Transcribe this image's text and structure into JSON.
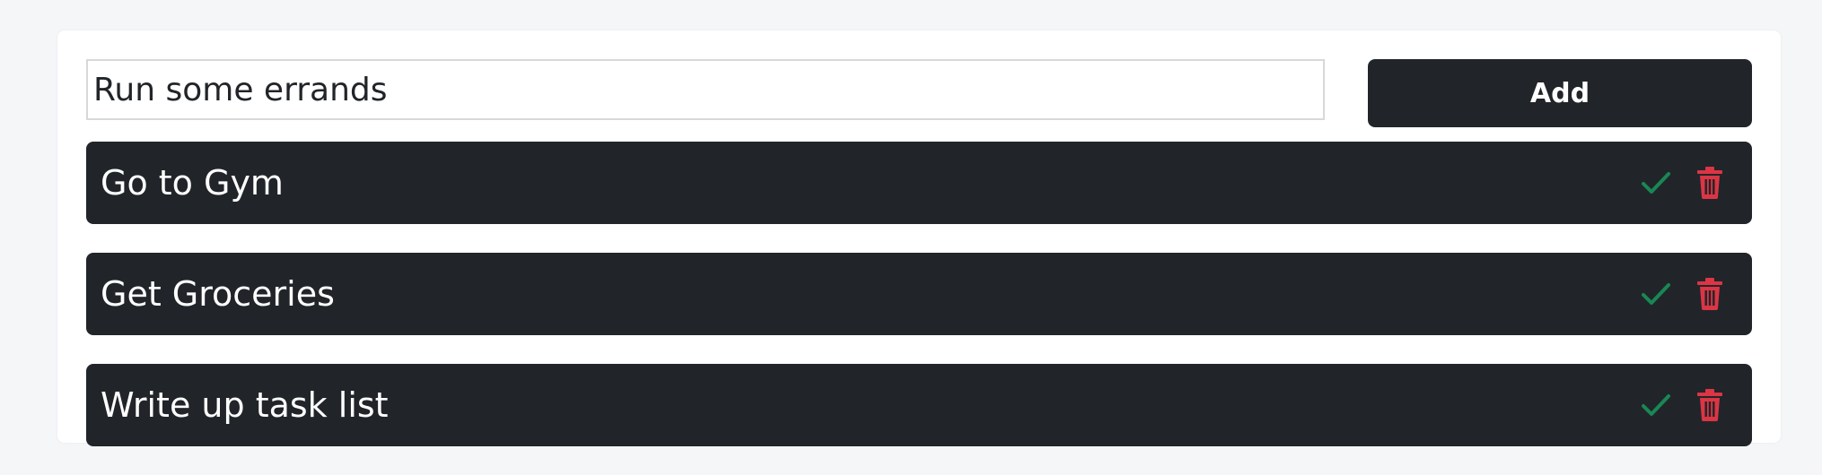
{
  "form": {
    "input_value": "Run some errands",
    "add_label": "Add"
  },
  "tasks": [
    {
      "label": "Go to Gym",
      "complete_icon": "check-icon",
      "delete_icon": "trash-icon"
    },
    {
      "label": "Get Groceries",
      "complete_icon": "check-icon",
      "delete_icon": "trash-icon"
    },
    {
      "label": "Write up task list",
      "complete_icon": "check-icon",
      "delete_icon": "trash-icon"
    }
  ],
  "colors": {
    "page_background": "#f5f6f8",
    "card_background": "#ffffff",
    "dark": "#212529",
    "success": "#198754",
    "danger": "#dc3545"
  }
}
